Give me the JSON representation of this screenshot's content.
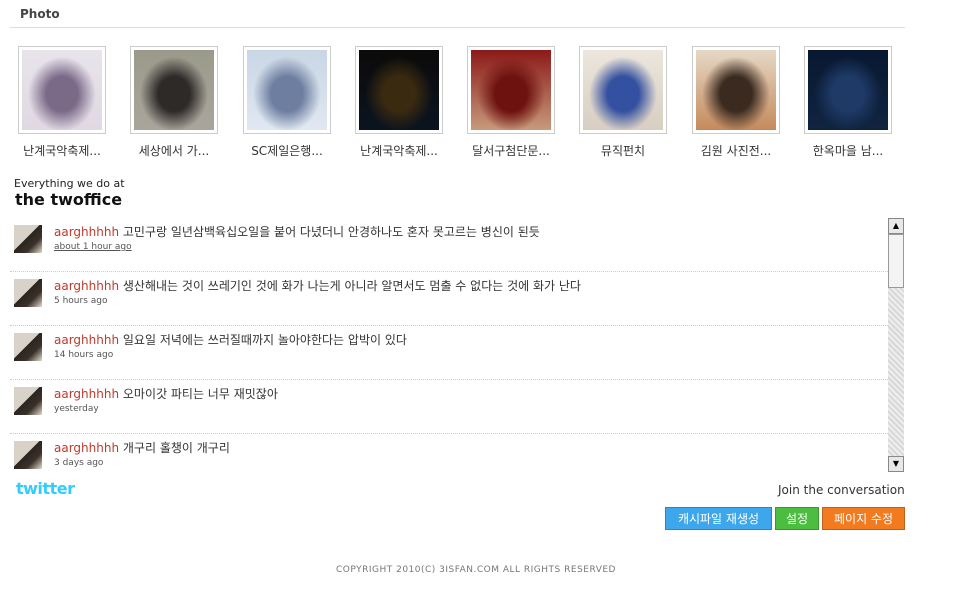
{
  "section": {
    "title": "Photo"
  },
  "photos": [
    {
      "caption": "난계국악축제...",
      "colors": [
        "#e8e4ec",
        "#7a6a88",
        "#e0d8e2"
      ]
    },
    {
      "caption": "세상에서 가...",
      "colors": [
        "#9a9a8a",
        "#2d2a28",
        "#aaa59c"
      ]
    },
    {
      "caption": "SC제일은행...",
      "colors": [
        "#c9d6e4",
        "#6d7ea0",
        "#e0e8f2"
      ]
    },
    {
      "caption": "난계국악축제...",
      "colors": [
        "#0c0a0a",
        "#3a2a10",
        "#0a1420"
      ]
    },
    {
      "caption": "달서구첨단문...",
      "colors": [
        "#8c1a18",
        "#6e120f",
        "#c79a7c"
      ]
    },
    {
      "caption": "뮤직펀치",
      "colors": [
        "#ece6dc",
        "#3450a0",
        "#d8cec2"
      ]
    },
    {
      "caption": "김원 사진전...",
      "colors": [
        "#e6d8c6",
        "#3a2a20",
        "#c48a5c"
      ]
    },
    {
      "caption": "한옥마을 남...",
      "colors": [
        "#081830",
        "#1e3a66",
        "#102440"
      ]
    }
  ],
  "tagline": {
    "small": "Everything we do at",
    "big": "the twoffice"
  },
  "tweets": [
    {
      "user": "aarghhhhh",
      "text": " 고민구랑 일년삼백육십오일을 붙어 다녔더니 안경하나도 혼자 못고르는 병신이 된듯",
      "time": "about 1 hour ago"
    },
    {
      "user": "aarghhhhh",
      "text": " 생산해내는 것이 쓰레기인 것에 화가 나는게 아니라 알면서도 멈출 수 없다는 것에 화가 난다",
      "time": "5 hours ago"
    },
    {
      "user": "aarghhhhh",
      "text": " 일요일 저녁에는 쓰러질때까지 놀아야한다는 압박이 있다",
      "time": "14 hours ago"
    },
    {
      "user": "aarghhhhh",
      "text": " 오마이갓 파티는 너무 재밋잖아",
      "time": "yesterday"
    },
    {
      "user": "aarghhhhh",
      "text": " 개구리 홀챙이 개구리",
      "time": "3 days ago"
    }
  ],
  "twitter": {
    "logo": "twitter",
    "join": "Join the conversation"
  },
  "buttons": {
    "regen": "캐시파일 재생성",
    "settings": "설정",
    "edit": "페이지 수정"
  },
  "colors": {
    "blue": "#3ea6ea",
    "green": "#4bbd3f",
    "orange": "#f27a1f",
    "username": "#c0392b"
  },
  "footer": "COPYRIGHT 2010(C) 3ISFAN.COM ALL RIGHTS RESERVED"
}
